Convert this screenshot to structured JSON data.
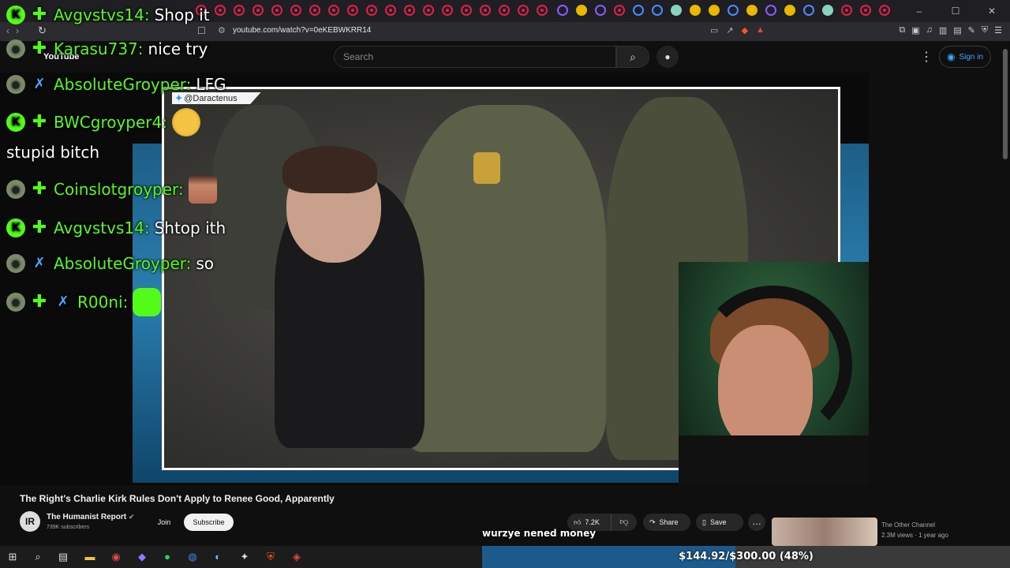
{
  "browser": {
    "url": "youtube.com/watch?v=0eKEBWKRR14",
    "window_controls": [
      "–",
      "☐",
      "✕"
    ]
  },
  "youtube": {
    "logo": "YouTube",
    "search_placeholder": "Search",
    "signin_label": "Sign in"
  },
  "video": {
    "source_tag": "@Daractenus",
    "title": "The Right's Charlie Kirk Rules Don't Apply to Renee Good, Apparently"
  },
  "chat": [
    {
      "user": "Avgvstvs14:",
      "message": "Shop it",
      "icons": [
        "k",
        "gem"
      ]
    },
    {
      "user": "Karasu737:",
      "message": "nice try",
      "icons": [
        "av",
        "gem"
      ]
    },
    {
      "user": "AbsoluteGroyper:",
      "message": "LFG",
      "icons": [
        "av",
        "sword"
      ]
    },
    {
      "user": "BWCgroyper4:",
      "message": "",
      "icons": [
        "k",
        "gem"
      ],
      "emote": "angry-emote"
    },
    {
      "user": "",
      "message": "stupid bitch",
      "icons": []
    },
    {
      "user": "Coinslotgroyper:",
      "message": "",
      "icons": [
        "av",
        "gem"
      ],
      "emote": "face-emote"
    },
    {
      "user": "Avgvstvs14:",
      "message": "Shtop ith",
      "icons": [
        "k",
        "gem"
      ]
    },
    {
      "user": "AbsoluteGroyper:",
      "message": "so",
      "icons": [
        "av",
        "sword"
      ]
    },
    {
      "user": "R00ni:",
      "message": "",
      "icons": [
        "av",
        "gem",
        "sword"
      ],
      "emote": "green-emote"
    }
  ],
  "channel": {
    "avatar_text": "IR",
    "name": "The Humanist Report",
    "subscribers": "739K subscribers",
    "join_label": "Join",
    "subscribe_label": "Subscribe"
  },
  "actions": {
    "likes": "7.2K",
    "share_label": "Share",
    "save_label": "Save"
  },
  "suggested": {
    "channel": "The Other Channel",
    "meta": "2.3M views · 1 year ago"
  },
  "stream_overlay": {
    "message": "wurzye nened money",
    "goal_text": "$144.92/$300.00 (48%)",
    "goal_fraction": 0.48
  },
  "colors": {
    "chat_username": "#53fc18",
    "youtube_link": "#3ea6ff",
    "goal_fill": "#1c5a8c"
  }
}
